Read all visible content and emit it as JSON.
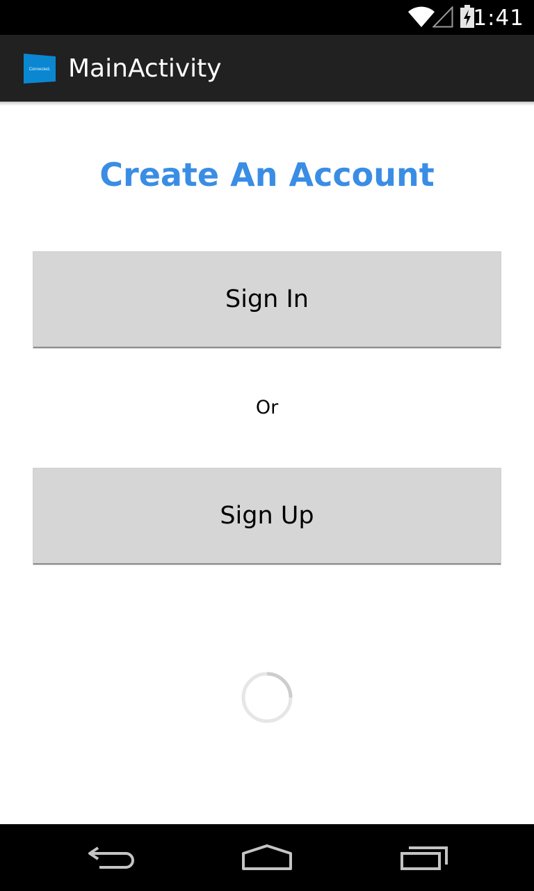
{
  "status_bar": {
    "time": "1:41",
    "icons": [
      "wifi-icon",
      "cell-signal-icon",
      "battery-charging-icon"
    ]
  },
  "action_bar": {
    "logo_text": "Connected.",
    "title": "MainActivity",
    "logo_color": "#0b87d1"
  },
  "main": {
    "heading": "Create An Account",
    "heading_color": "#3a8de4",
    "sign_in_label": "Sign In",
    "or_label": "Or",
    "sign_up_label": "Sign Up",
    "loading_indicator": "spinner-icon"
  },
  "nav_bar": {
    "buttons": [
      "back-icon",
      "home-icon",
      "recent-apps-icon"
    ]
  }
}
